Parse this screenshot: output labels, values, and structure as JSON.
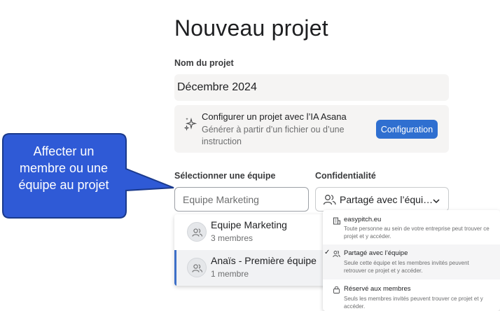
{
  "page": {
    "title": "Nouveau projet"
  },
  "form": {
    "name_label": "Nom du projet",
    "name_value": "Décembre 2024",
    "ai": {
      "title": "Configurer un projet avec l’IA Asana",
      "subtitle": "Générer à partir d’un fichier ou d’une instruction",
      "button": "Configuration",
      "icon": "sparkle-icon"
    },
    "team_label": "Sélectionner une équipe",
    "team_value": "Equipe Marketing",
    "privacy_label": "Confidentialité",
    "privacy_value": "Partagé avec l’équi…",
    "privacy_icon": "people-icon",
    "chevron_icon": "chevron-down-icon"
  },
  "team_options": [
    {
      "name": "Equipe Marketing",
      "members": "3 membres",
      "selected": false
    },
    {
      "name": "Anaïs - Première équipe",
      "members": "1 membre",
      "selected": true
    }
  ],
  "privacy_options": [
    {
      "title": "easypitch.eu",
      "desc": "Toute personne au sein de votre entreprise peut trouver ce projet et y accéder.",
      "icon": "building-icon",
      "checked": false
    },
    {
      "title": "Partagé avec l’équipe",
      "desc": "Seule cette équipe et les membres invités peuvent retrouver ce projet et y accéder.",
      "icon": "people-icon",
      "checked": true
    },
    {
      "title": "Réservé aux membres",
      "desc": "Seuls les membres invités peuvent trouver ce projet et y accéder.",
      "icon": "lock-icon",
      "checked": false
    }
  ],
  "callout": {
    "text": "Affecter un membre ou une équipe au projet"
  },
  "colors": {
    "accent": "#2f6fd0",
    "callout_fill": "#2f5ad6",
    "callout_border": "#1b3a8c"
  }
}
